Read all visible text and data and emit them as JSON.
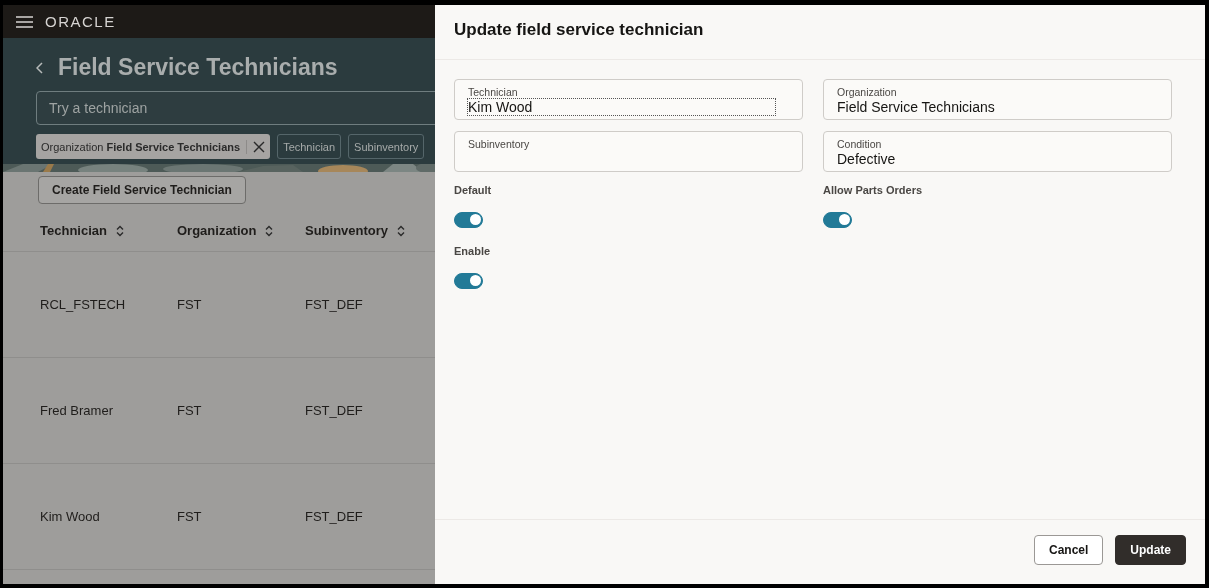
{
  "header": {
    "logo": "ORACLE"
  },
  "page": {
    "title": "Field Service Technicians",
    "search": {
      "placeholder": "Try a technician"
    },
    "chips": [
      {
        "kind": "applied",
        "label": "Organization",
        "value": "Field Service Technicians"
      },
      {
        "kind": "filter",
        "label": "Technician"
      },
      {
        "kind": "filter",
        "label": "Subinventory"
      }
    ],
    "create_button": "Create Field Service Technician"
  },
  "table": {
    "columns": [
      "Technician",
      "Organization",
      "Subinventory"
    ],
    "rows": [
      [
        "RCL_FSTECH",
        "FST",
        "FST_DEF"
      ],
      [
        "Fred Bramer",
        "FST",
        "FST_DEF"
      ],
      [
        "Kim Wood",
        "FST",
        "FST_DEF"
      ]
    ]
  },
  "drawer": {
    "title": "Update field service technician",
    "fields": [
      {
        "label": "Technician",
        "value": "Kim Wood",
        "focused": true
      },
      {
        "label": "Organization",
        "value": "Field Service Technicians",
        "focused": false
      },
      {
        "label": "Subinventory",
        "focused": false
      },
      {
        "label": "Condition",
        "value": "Defective",
        "focused": false
      }
    ],
    "toggles": [
      {
        "label": "Default",
        "on": true
      },
      {
        "label": "Allow Parts Orders",
        "on": true
      },
      {
        "label": "Enable",
        "on": true
      }
    ],
    "buttons": [
      {
        "kind": "secondary",
        "label": "Cancel"
      },
      {
        "kind": "primary",
        "label": "Update"
      }
    ]
  }
}
